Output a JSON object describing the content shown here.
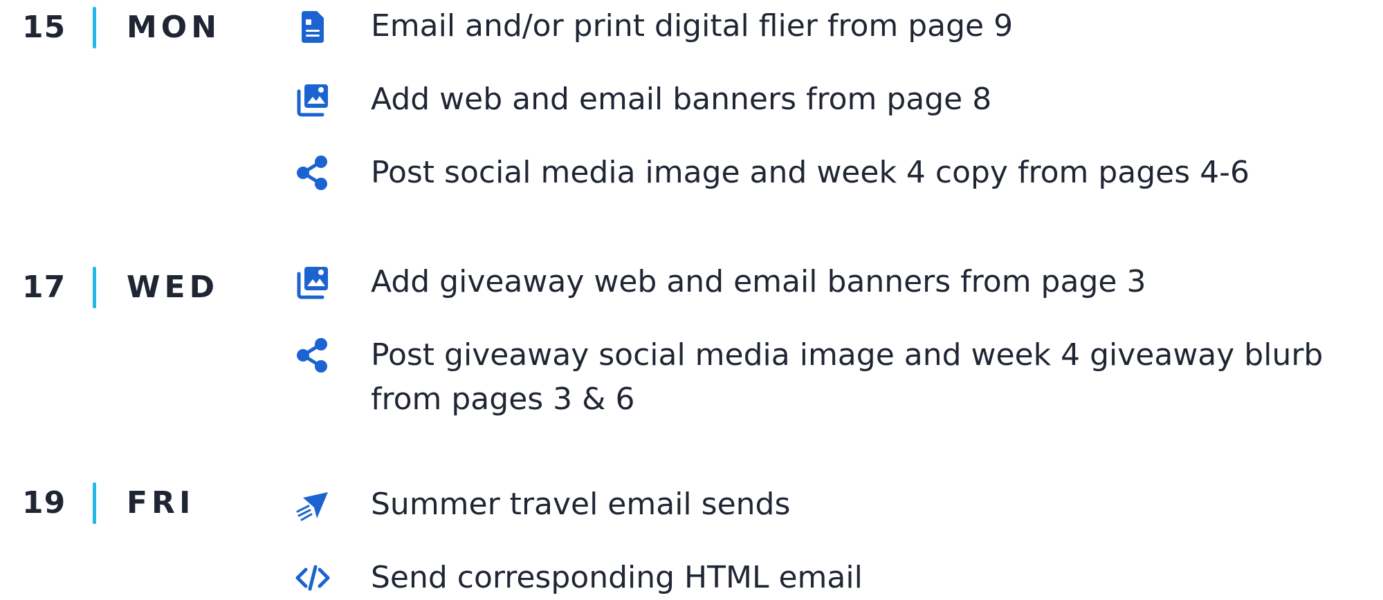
{
  "colors": {
    "accent": "#22b8ea",
    "icon": "#1a63d1",
    "text": "#1f2533"
  },
  "days": [
    {
      "number": "15",
      "name": "MON",
      "tasks": [
        {
          "icon": "document-icon",
          "text": "Email and/or print digital flier from page 9"
        },
        {
          "icon": "image-gallery-icon",
          "text": "Add web and email banners from page 8"
        },
        {
          "icon": "share-icon",
          "text": "Post social media image and week 4 copy from pages 4-6"
        }
      ]
    },
    {
      "number": "17",
      "name": "WED",
      "tasks": [
        {
          "icon": "image-gallery-icon",
          "text": "Add giveaway web and email banners from page 3"
        },
        {
          "icon": "share-icon",
          "text": "Post giveaway social media image and week 4 giveaway blurb",
          "text2": "from pages 3 & 6"
        }
      ]
    },
    {
      "number": "19",
      "name": "FRI",
      "tasks": [
        {
          "icon": "send-icon",
          "text": "Summer travel email sends"
        },
        {
          "icon": "code-icon",
          "text": "Send corresponding HTML email"
        }
      ]
    }
  ]
}
